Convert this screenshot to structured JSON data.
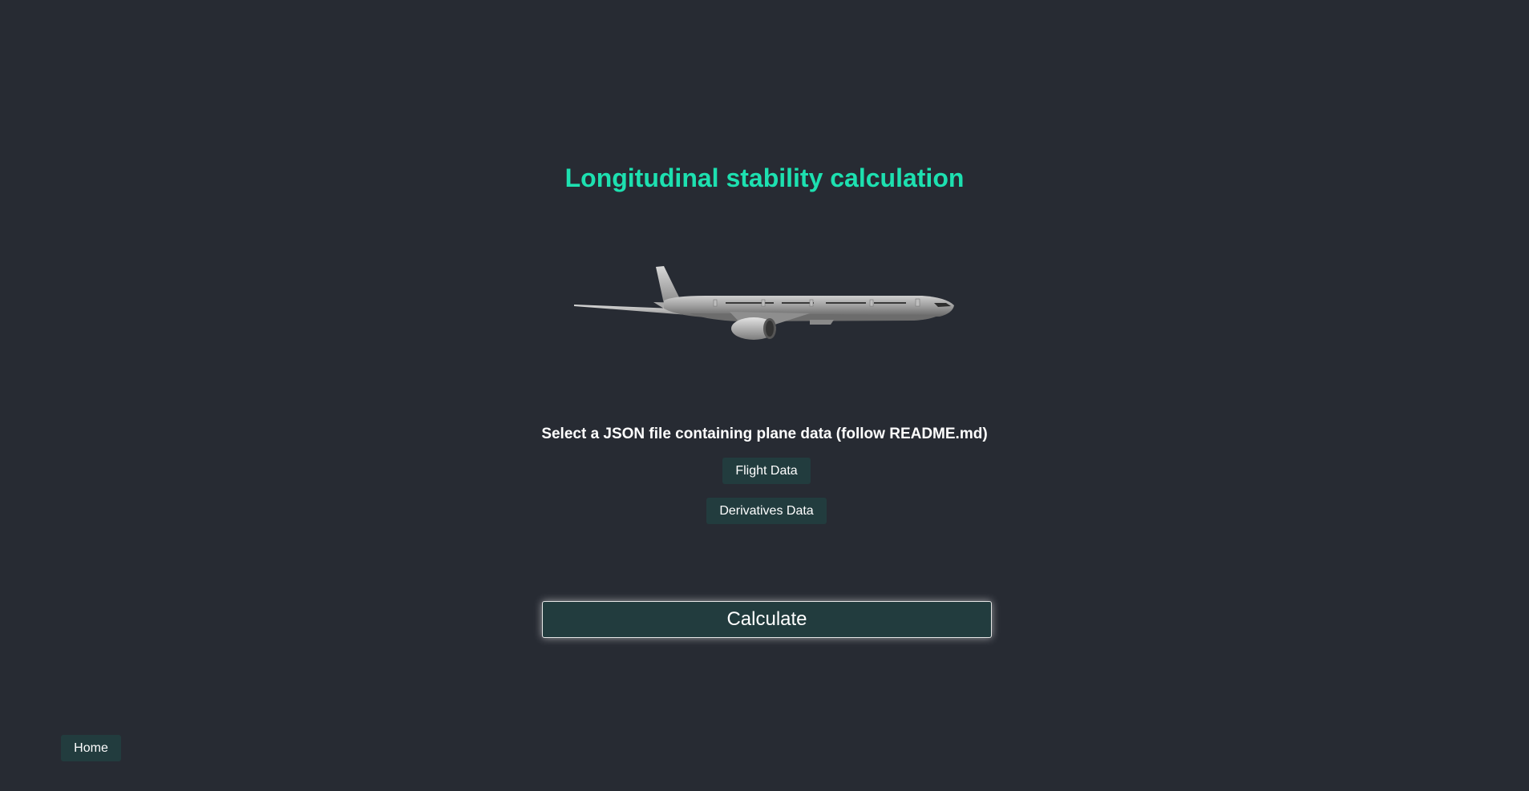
{
  "page": {
    "title": "Longitudinal stability calculation",
    "instructions": "Select a JSON file containing plane data (follow README.md)"
  },
  "buttons": {
    "flight_data": "Flight Data",
    "derivatives_data": "Derivatives Data",
    "calculate": "Calculate",
    "home": "Home"
  },
  "colors": {
    "background": "#272b33",
    "accent": "#1de0b0",
    "button_bg": "#223c3e",
    "text": "#ffffff"
  },
  "image": {
    "subject": "airplane-illustration"
  }
}
